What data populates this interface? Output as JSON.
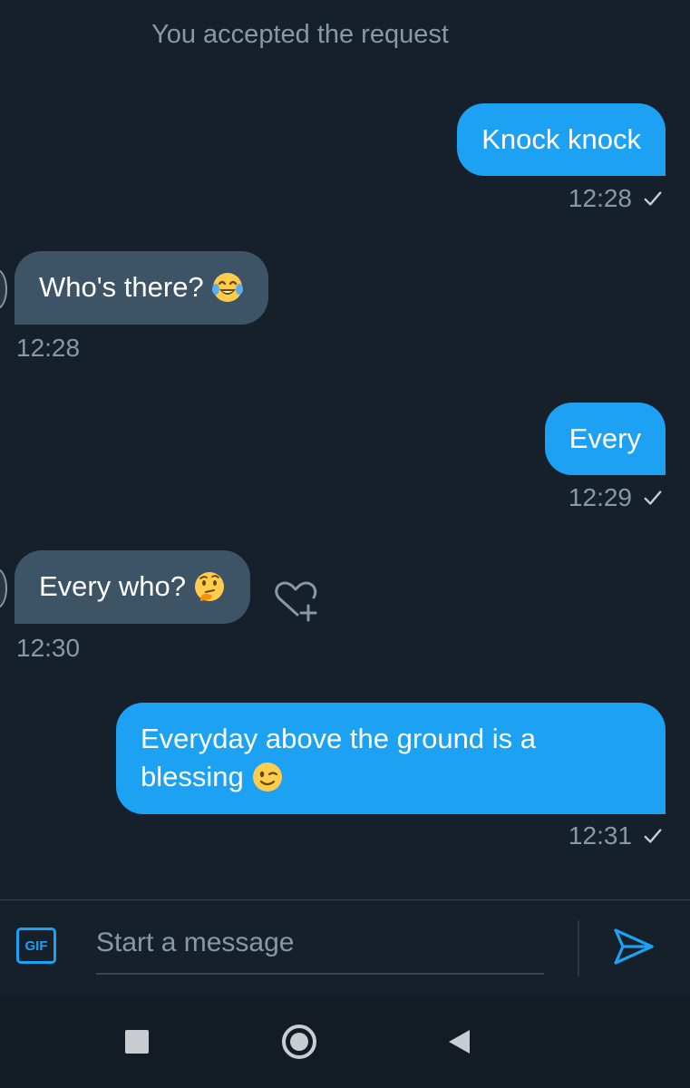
{
  "system_note": "You accepted the request",
  "messages": [
    {
      "text": "Knock knock",
      "time": "12:28"
    },
    {
      "text": "Who's there?",
      "emoji": "face-with-tears-of-joy",
      "time": "12:28"
    },
    {
      "text": "Every",
      "time": "12:29"
    },
    {
      "text": "Every who?",
      "emoji": "thinking-face",
      "time": "12:30"
    },
    {
      "text": "Everyday above the ground is a blessing",
      "emoji": "winking-face",
      "time": "12:31"
    }
  ],
  "composer": {
    "gif_label": "GIF",
    "placeholder": "Start a message"
  },
  "colors": {
    "background": "#15202b",
    "sent_bubble": "#1da1f2",
    "received_bubble": "#3d5466",
    "muted_text": "#8899a6"
  }
}
